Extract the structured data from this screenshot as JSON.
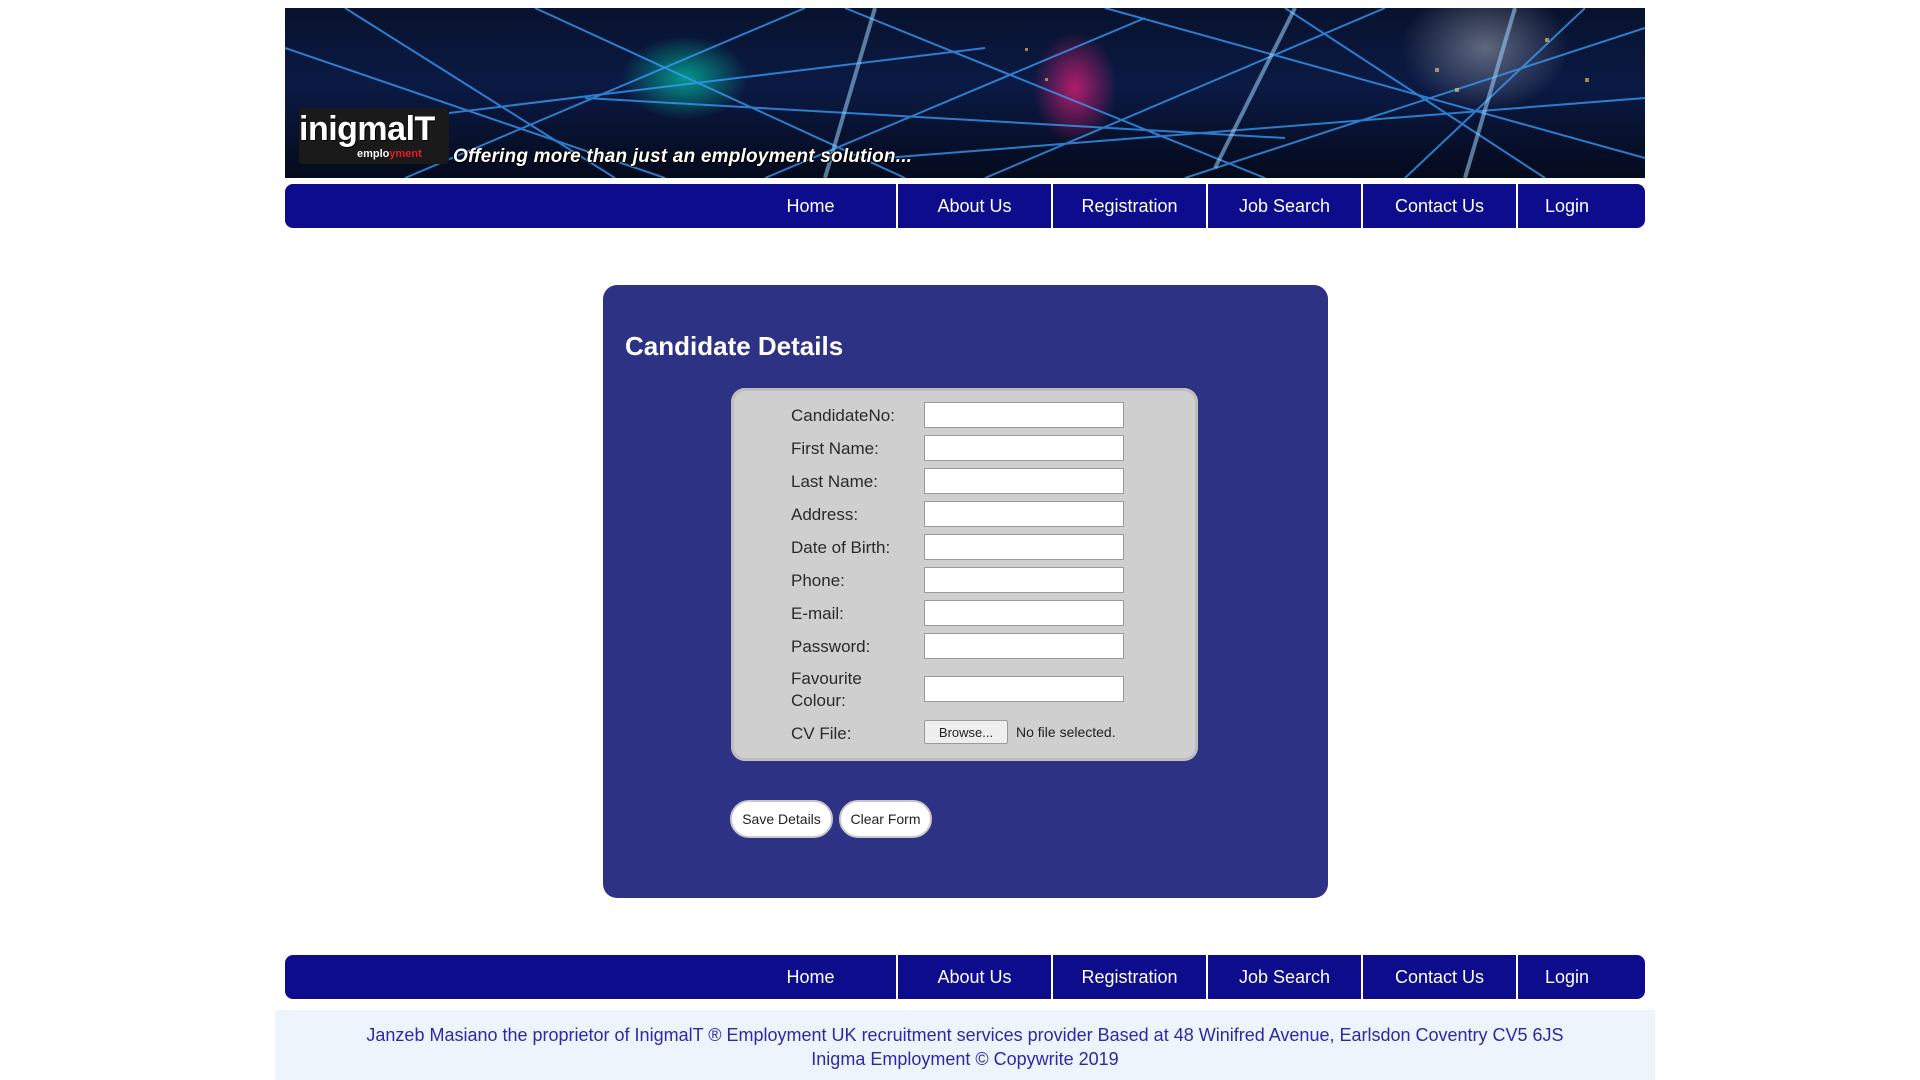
{
  "banner": {
    "logo_main": "inigmalT",
    "logo_sub": "employment",
    "tagline": "Offering more than just an employment solution..."
  },
  "nav": {
    "items": [
      {
        "label": "Home"
      },
      {
        "label": "About Us"
      },
      {
        "label": "Registration"
      },
      {
        "label": "Job Search"
      },
      {
        "label": "Contact Us"
      },
      {
        "label": "Login"
      }
    ]
  },
  "form": {
    "title": "Candidate Details",
    "fields": [
      {
        "label": "CandidateNo:",
        "value": ""
      },
      {
        "label": "First Name:",
        "value": ""
      },
      {
        "label": "Last Name:",
        "value": ""
      },
      {
        "label": "Address:",
        "value": ""
      },
      {
        "label": "Date of Birth:",
        "value": ""
      },
      {
        "label": "Phone:",
        "value": ""
      },
      {
        "label": "E-mail:",
        "value": ""
      },
      {
        "label": "Password:",
        "value": ""
      },
      {
        "label": "Favourite Colour:",
        "value": ""
      }
    ],
    "cv_label": "CV File:",
    "browse_label": "Browse...",
    "file_status": "No file selected.",
    "save_label": "Save Details",
    "clear_label": "Clear Form"
  },
  "footer": {
    "line1": "Janzeb Masiano the proprietor of InigmalT ® Employment UK recruitment services provider Based at 48 Winifred Avenue, Earlsdon Coventry CV5 6JS",
    "line2": "Inigma Employment © Copywrite 2019"
  },
  "colors": {
    "nav_bg": "#0c0c8c",
    "panel_bg": "#2e3284",
    "form_bg": "#cfcfcf",
    "footer_text": "#2a2aa6"
  }
}
